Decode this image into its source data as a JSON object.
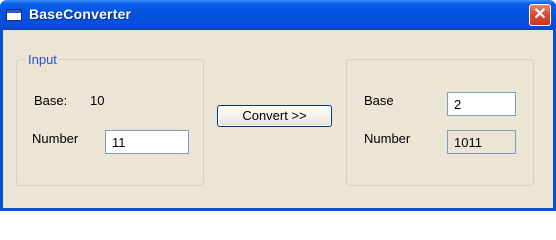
{
  "window": {
    "title": "BaseConverter",
    "icon": "window-app-icon",
    "close_icon": "close-icon"
  },
  "input_group": {
    "legend": "Input",
    "base_label": "Base:",
    "base_value": "10",
    "number_label": "Number",
    "number_value": "11"
  },
  "convert_button": {
    "label": "Convert >>"
  },
  "output_group": {
    "base_label": "Base",
    "base_value": "2",
    "number_label": "Number",
    "number_value": "1011"
  },
  "colors": {
    "titlebar": "#0a4fd6",
    "client_background": "#ece4d5",
    "legend_text": "#2554c7",
    "close_button": "#d9482a"
  }
}
